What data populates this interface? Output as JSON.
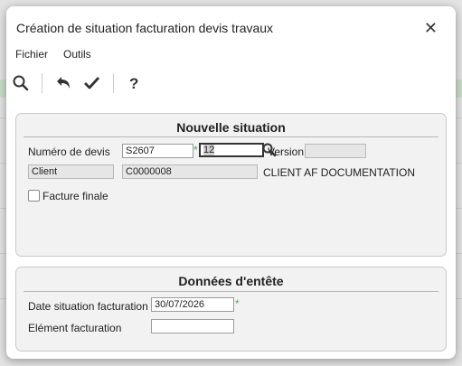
{
  "window": {
    "title": "Création de situation facturation devis travaux",
    "close_label": "✕"
  },
  "menu": {
    "items": [
      "Fichier",
      "Outils"
    ]
  },
  "toolbar": {
    "icons": [
      "search-icon",
      "undo-icon",
      "check-icon",
      "help-icon"
    ]
  },
  "situation": {
    "title": "Nouvelle situation",
    "numero_devis_label": "Numéro de devis",
    "numero_devis_value": "S2607",
    "numero_situation_value": "12",
    "version_label": "Version",
    "version_value": "",
    "client_label": "Client",
    "client_code": "C0000008",
    "client_name": "CLIENT AF  DOCUMENTATION",
    "facture_finale_label": "Facture finale",
    "facture_finale_checked": false,
    "required_marker": "*"
  },
  "entete": {
    "title": "Données d'entête",
    "date_label": "Date situation facturation",
    "date_value": "30/07/2026",
    "element_label": "Elément facturation",
    "element_value": "",
    "required_marker": "*"
  },
  "colors": {
    "accent_green": "#5aa55a",
    "panel_bg": "#f2f2f2"
  }
}
